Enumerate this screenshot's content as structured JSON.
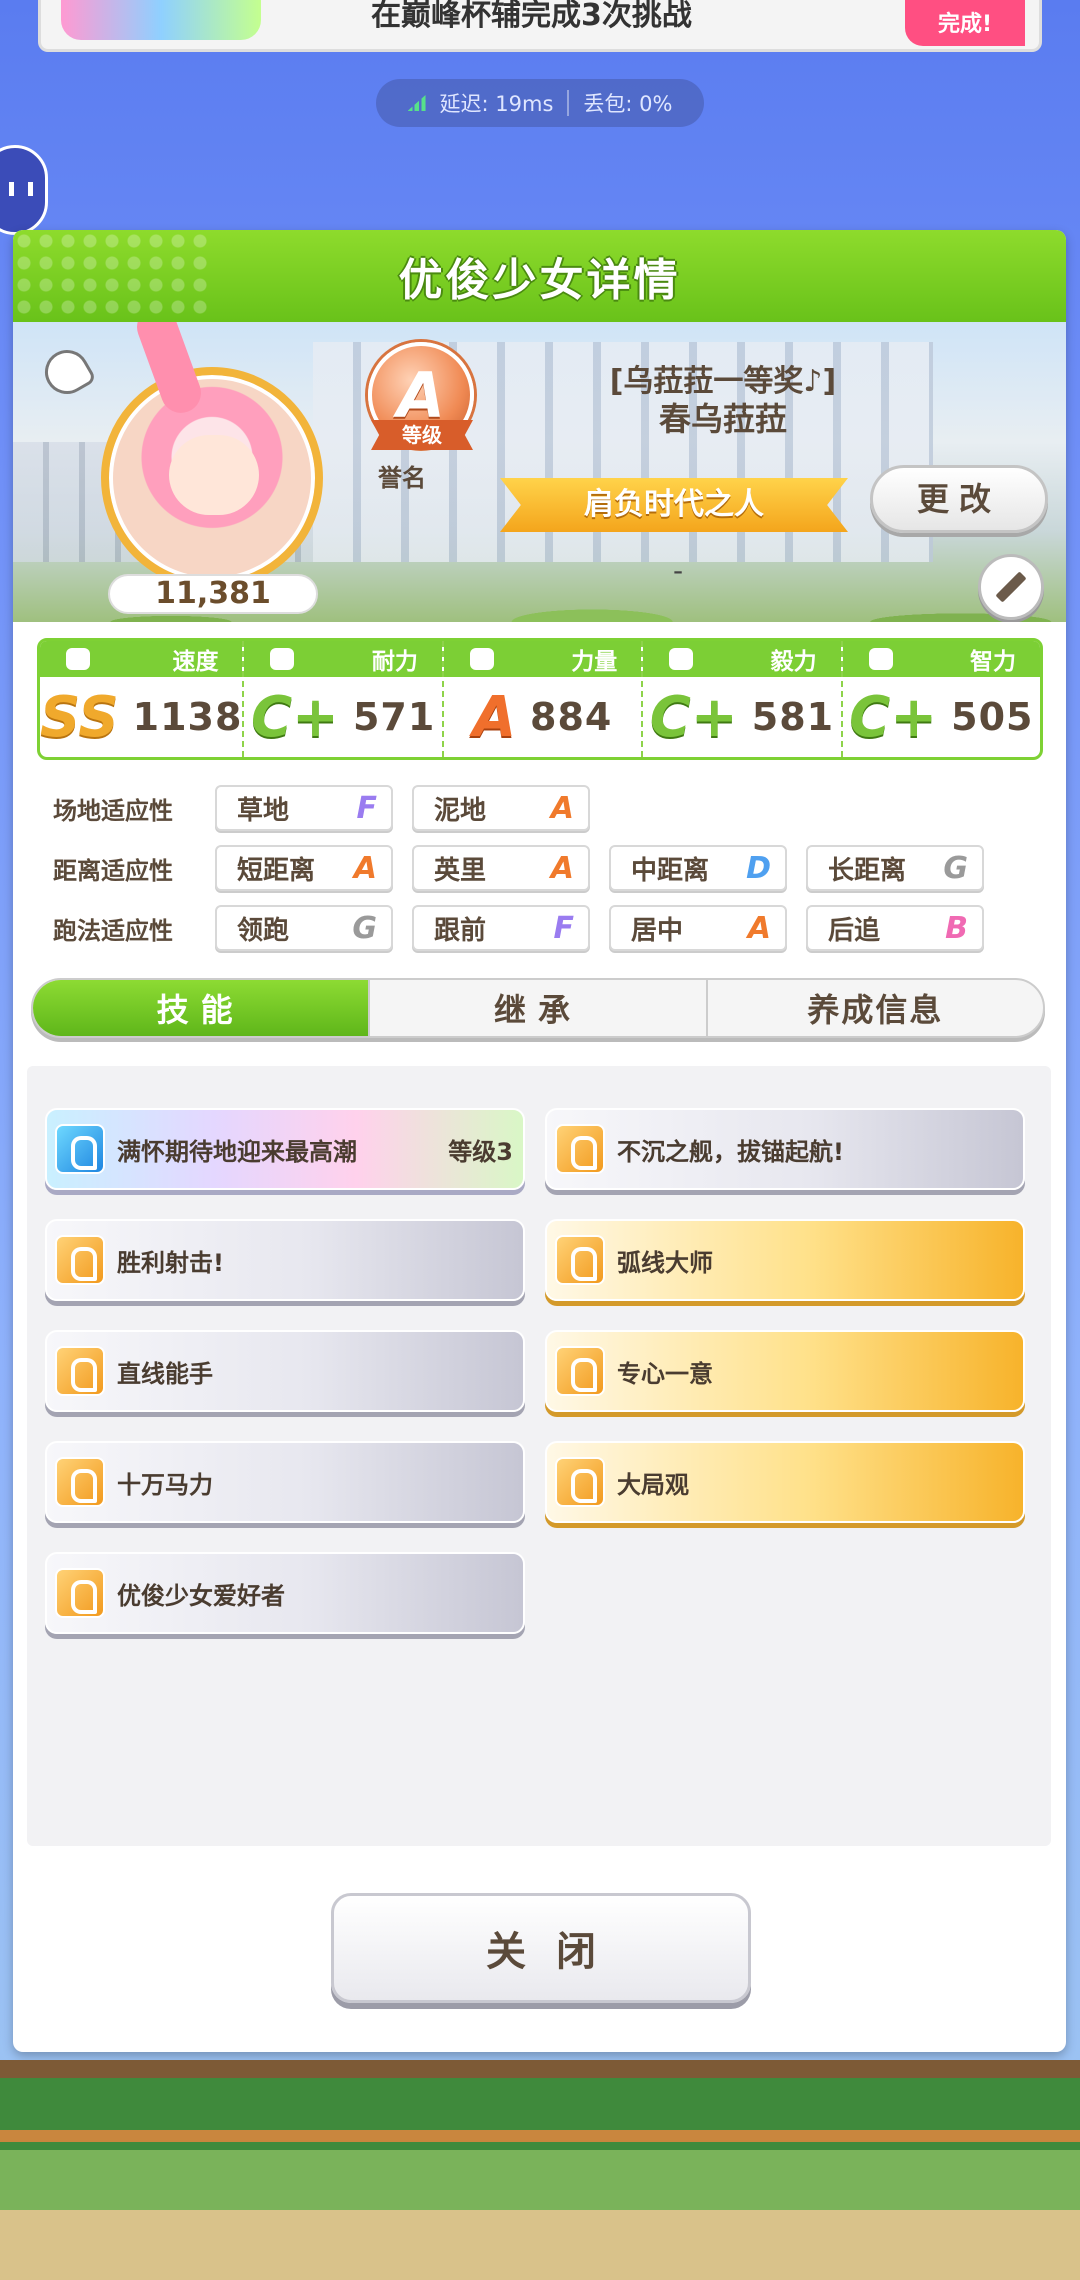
{
  "top_banner": {
    "text": "在巅峰杯辅完成3次挑战",
    "badge": "完成!"
  },
  "network": {
    "latency": "延迟: 19ms",
    "packet_loss": "丢包: 0%"
  },
  "dialog": {
    "title": "优俊少女详情",
    "fans": "11,381",
    "rank": {
      "grade": "A",
      "ribbon": "等级",
      "fame_label": "誉名"
    },
    "title_line": "[乌菈菈一等奖♪]",
    "name": "春乌菈菈",
    "epithet": "肩负时代之人",
    "change_button": "更改",
    "secondary_title": "-",
    "stats": [
      {
        "label": "速度",
        "grade": "SS",
        "value": "1138",
        "grade_color": "#f0a92c"
      },
      {
        "label": "耐力",
        "grade": "C+",
        "value": "571",
        "grade_color": "#7ac43a"
      },
      {
        "label": "力量",
        "grade": "A",
        "value": "884",
        "grade_color": "#f06f2c"
      },
      {
        "label": "毅力",
        "grade": "C+",
        "value": "581",
        "grade_color": "#7ac43a"
      },
      {
        "label": "智力",
        "grade": "C+",
        "value": "505",
        "grade_color": "#7ac43a"
      }
    ],
    "aptitude": {
      "track": {
        "label": "场地适应性",
        "items": [
          {
            "name": "草地",
            "grade": "F"
          },
          {
            "name": "泥地",
            "grade": "A"
          }
        ]
      },
      "distance": {
        "label": "距离适应性",
        "items": [
          {
            "name": "短距离",
            "grade": "A"
          },
          {
            "name": "英里",
            "grade": "A"
          },
          {
            "name": "中距离",
            "grade": "D"
          },
          {
            "name": "长距离",
            "grade": "G"
          }
        ]
      },
      "style": {
        "label": "跑法适应性",
        "items": [
          {
            "name": "领跑",
            "grade": "G"
          },
          {
            "name": "跟前",
            "grade": "F"
          },
          {
            "name": "居中",
            "grade": "A"
          },
          {
            "name": "后追",
            "grade": "B"
          }
        ]
      }
    },
    "tabs": [
      "技能",
      "继承",
      "养成信息"
    ],
    "skills": [
      {
        "name": "满怀期待地迎来最高潮",
        "level": "等级3",
        "style": "rainbow",
        "icon": "sparkle-icon"
      },
      {
        "name": "不沉之舰，拔锚起航!",
        "style": "silver",
        "icon": "runner-icon"
      },
      {
        "name": "胜利射击!",
        "style": "silver",
        "icon": "runner-icon"
      },
      {
        "name": "弧线大师",
        "style": "gold",
        "icon": "runner-icon"
      },
      {
        "name": "直线能手",
        "style": "silver",
        "icon": "runner-icon"
      },
      {
        "name": "专心一意",
        "style": "gold",
        "icon": "focus-icon"
      },
      {
        "name": "十万马力",
        "style": "silver",
        "icon": "runner-icon"
      },
      {
        "name": "大局观",
        "style": "gold",
        "icon": "flag-icon"
      },
      {
        "name": "优俊少女爱好者",
        "style": "silver",
        "icon": "runner-icon"
      }
    ],
    "close_button": "关闭"
  }
}
